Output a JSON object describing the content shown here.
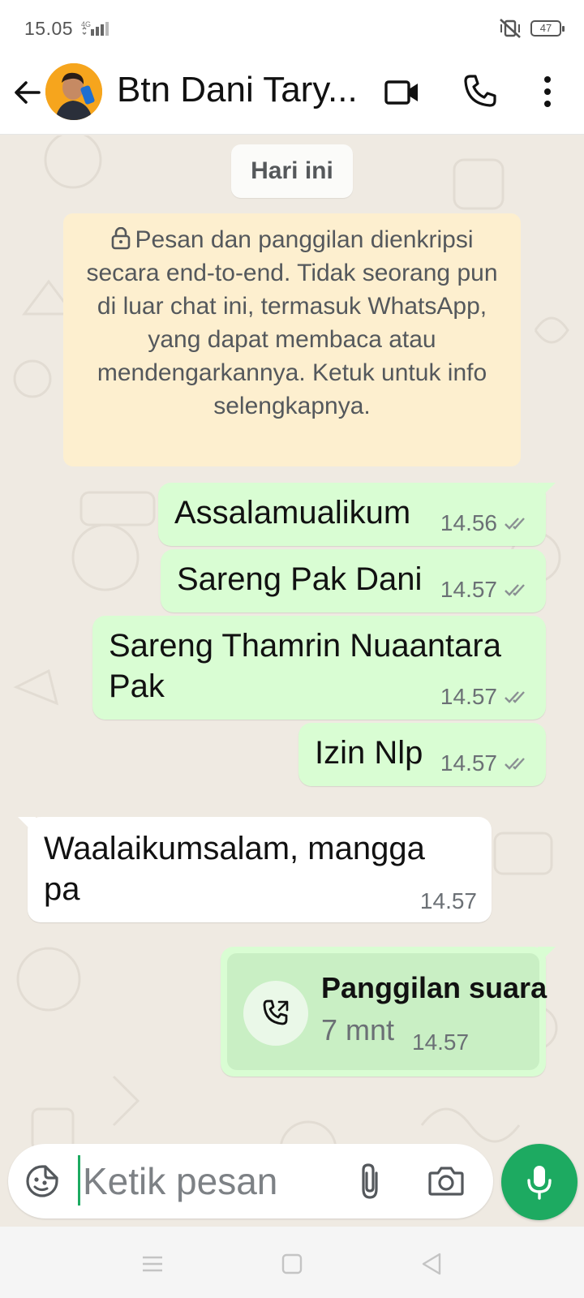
{
  "status_bar": {
    "time": "15.05",
    "network": "4G",
    "battery": "47",
    "icons": [
      "signal-icon",
      "mute-vibrate-icon",
      "battery-icon"
    ]
  },
  "header": {
    "contact_name": "Btn Dani Tary...",
    "icons": [
      "back-arrow-icon",
      "avatar",
      "video-call-icon",
      "voice-call-icon",
      "more-vert-icon"
    ]
  },
  "chat": {
    "date_label": "Hari ini",
    "encryption_notice": "Pesan dan panggilan dienkripsi secara end-to-end. Tidak seorang pun di luar chat ini, termasuk WhatsApp, yang dapat membaca atau mendengarkannya. Ketuk untuk info selengkapnya.",
    "messages": [
      {
        "direction": "out",
        "text": "Assalamualikum",
        "time": "14.56",
        "status": "read"
      },
      {
        "direction": "out",
        "text": "Sareng Pak Dani",
        "time": "14.57",
        "status": "read"
      },
      {
        "direction": "out",
        "text": "Sareng Thamrin Nuaantara Pak",
        "time": "14.57",
        "status": "read"
      },
      {
        "direction": "out",
        "text": "Izin Nlp",
        "time": "14.57",
        "status": "read"
      },
      {
        "direction": "in",
        "text": "Waalaikumsalam, mangga pa",
        "time": "14.57"
      },
      {
        "direction": "out",
        "type": "voice-call",
        "title": "Panggilan suara",
        "duration": "7 mnt",
        "time": "14.57"
      }
    ]
  },
  "composer": {
    "placeholder": "Ketik pesan",
    "icons": [
      "emoji-sticker-icon",
      "attach-icon",
      "camera-icon",
      "mic-icon"
    ],
    "accent": "#1daa61"
  },
  "colors": {
    "outgoing_bubble": "#d9fdd3",
    "incoming_bubble": "#ffffff",
    "notice_bubble": "#fdefcf",
    "wallpaper": "#efeae2",
    "read_tick": "#8a8f93"
  }
}
